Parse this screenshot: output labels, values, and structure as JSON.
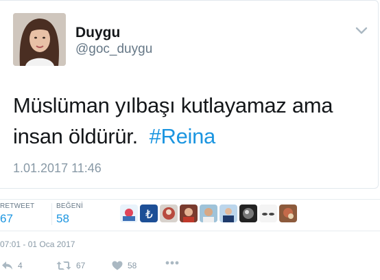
{
  "tweet": {
    "display_name": "Duygu",
    "handle": "@goc_duygu",
    "text_plain": "Müslüman yılbaşı kutlayamaz ama insan öldürür.",
    "hashtag": "#Reina",
    "timestamp": "1.01.2017 11:46"
  },
  "stats": {
    "retweet_label": "RETWEET",
    "retweet_count": "67",
    "like_label": "BEĞENİ",
    "like_count": "58"
  },
  "detail_time": "07:01 - 01 Oca 2017",
  "actions": {
    "reply_count": "4",
    "retweet_count": "67",
    "like_count": "58"
  },
  "colors": {
    "link": "#1b95e0",
    "muted": "#8899a6",
    "text": "#14171a"
  },
  "icons": [
    "chevron-down-icon",
    "reply-icon",
    "retweet-icon",
    "heart-icon",
    "more-icon"
  ]
}
